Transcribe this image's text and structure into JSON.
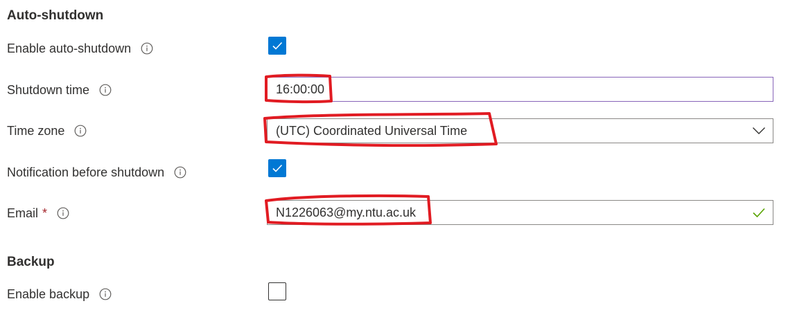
{
  "auto_shutdown": {
    "title": "Auto-shutdown",
    "enable": {
      "label": "Enable auto-shutdown",
      "checked": true
    },
    "shutdown_time": {
      "label": "Shutdown time",
      "value": "16:00:00"
    },
    "time_zone": {
      "label": "Time zone",
      "value": "(UTC) Coordinated Universal Time"
    },
    "notification": {
      "label": "Notification before shutdown",
      "checked": true
    },
    "email": {
      "label": "Email",
      "required_mark": "*",
      "value": "N1226063@my.ntu.ac.uk",
      "valid": true
    }
  },
  "backup": {
    "title": "Backup",
    "enable": {
      "label": "Enable backup",
      "checked": false
    }
  },
  "colors": {
    "accent": "#0078d4",
    "text": "#323130",
    "required": "#a4262c",
    "valid": "#57a300",
    "annotation": "#e11b22",
    "focus_border": "#8764b8"
  },
  "icons": {
    "info": "info-icon",
    "check": "checkmark-icon",
    "chevron": "chevron-down-icon",
    "valid": "valid-check-icon"
  }
}
